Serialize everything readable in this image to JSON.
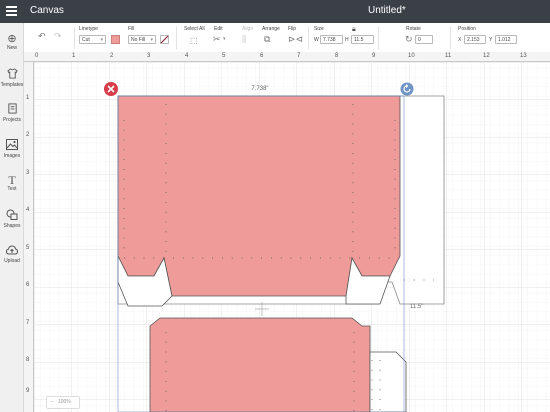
{
  "app": {
    "title": "Canvas",
    "document_title": "Untitled*"
  },
  "sidebar": {
    "items": [
      {
        "label": "New",
        "icon": "plus-circle-icon"
      },
      {
        "label": "Templates",
        "icon": "shirt-icon"
      },
      {
        "label": "Projects",
        "icon": "projects-icon"
      },
      {
        "label": "Images",
        "icon": "image-icon"
      },
      {
        "label": "Text",
        "icon": "text-icon"
      },
      {
        "label": "Shapes",
        "icon": "shapes-icon"
      },
      {
        "label": "Upload",
        "icon": "upload-cloud-icon"
      }
    ]
  },
  "toolbar": {
    "linetype_label": "Linetype",
    "linetype_value": "Cut",
    "fill_label": "Fill",
    "fill_value": "No Fill",
    "select_all_label": "Select All",
    "edit_label": "Edit",
    "align_label": "Align",
    "arrange_label": "Arrange",
    "flip_label": "Flip",
    "size_label": "Size",
    "size_w_label": "W",
    "size_w_value": "7.738",
    "size_h_label": "H",
    "size_h_value": "11.5",
    "rotate_label": "Rotate",
    "rotate_value": "0",
    "position_label": "Position",
    "pos_x_label": "X",
    "pos_x_value": "2.153",
    "pos_y_label": "Y",
    "pos_y_value": "1.012"
  },
  "ruler": {
    "top": [
      "0",
      "1",
      "2",
      "3",
      "4",
      "5",
      "6",
      "7",
      "8",
      "9",
      "10",
      "11",
      "12",
      "13"
    ],
    "left": [
      "1",
      "2",
      "3",
      "4",
      "5",
      "6",
      "7",
      "8",
      "9"
    ]
  },
  "canvas": {
    "selection_width": "7.738\"",
    "selection_height": "11.5\"",
    "zoom": "100%",
    "colors": {
      "shape_fill": "#ee9b99",
      "delete_badge": "#d83b4a",
      "rotate_badge": "#6f93c4",
      "grid": "#e4e4e4"
    }
  }
}
